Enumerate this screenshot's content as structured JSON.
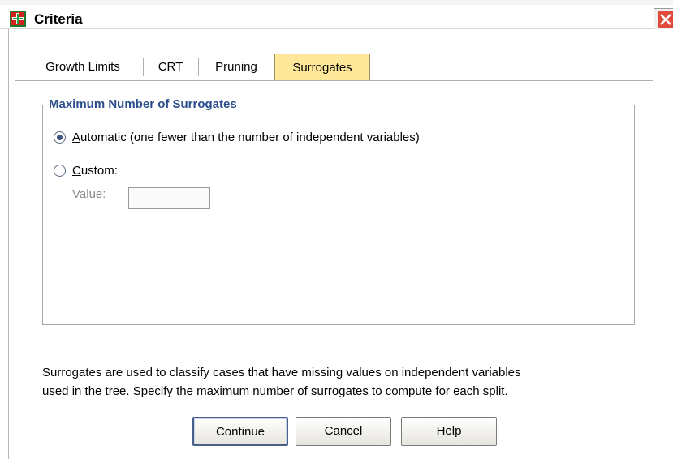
{
  "window": {
    "title": "Criteria"
  },
  "tabs": [
    {
      "label": "Growth Limits",
      "active": false
    },
    {
      "label": "CRT",
      "active": false
    },
    {
      "label": "Pruning",
      "active": false
    },
    {
      "label": "Surrogates",
      "active": true
    }
  ],
  "group": {
    "title": "Maximum Number of Surrogates",
    "options": [
      {
        "accel": "A",
        "rest": "utomatic (one fewer than the number of independent variables)",
        "selected": true
      },
      {
        "accel": "C",
        "rest": "ustom:",
        "selected": false
      }
    ],
    "value": {
      "accel": "V",
      "rest": "alue:",
      "current": ""
    }
  },
  "description": {
    "line1": "Surrogates are used to classify cases that have missing values on independent variables",
    "line2": "used in the tree. Specify the maximum number of surrogates to compute for each split."
  },
  "buttons": {
    "continue": "Continue",
    "cancel": "Cancel",
    "help": "Help"
  },
  "colors": {
    "active_tab": "#ffe89a",
    "group_title": "#2a4d8c",
    "close_button": "#e04a3a"
  },
  "icons": {
    "app": "spss-dialog-icon",
    "close": "close-icon"
  }
}
